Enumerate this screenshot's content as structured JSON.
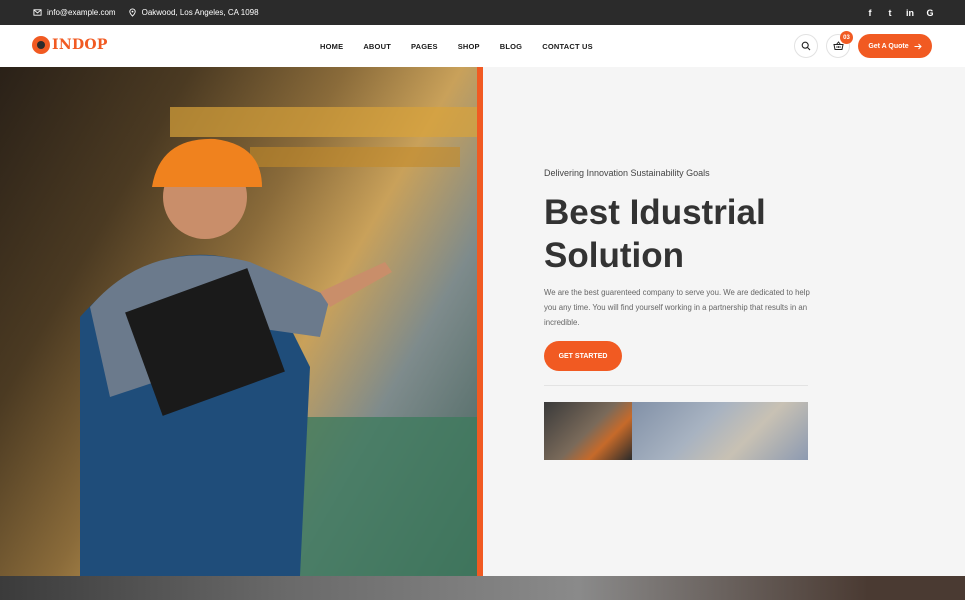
{
  "topbar": {
    "email": "info@example.com",
    "address": "Oakwood, Los Angeles, CA 1098",
    "social": [
      "f",
      "t",
      "in",
      "G"
    ]
  },
  "header": {
    "logo_text": "INDOP",
    "nav": [
      "HOME",
      "ABOUT",
      "PAGES",
      "SHOP",
      "BLOG",
      "CONTACT US"
    ],
    "cart_count": "03",
    "quote_label": "Get A Quote"
  },
  "hero": {
    "subtitle": "Delivering Innovation Sustainability Goals",
    "title": "Best Idustrial Solution",
    "description": "We are the best guarenteed company to serve you. We are dedicated to help you any time. You will find yourself working in a partnership that results in an incredible.",
    "cta_label": "GET STARTED"
  },
  "colors": {
    "accent": "#f15a22",
    "topbar": "#2b2b2b",
    "hero_bg": "#f5f5f5"
  }
}
